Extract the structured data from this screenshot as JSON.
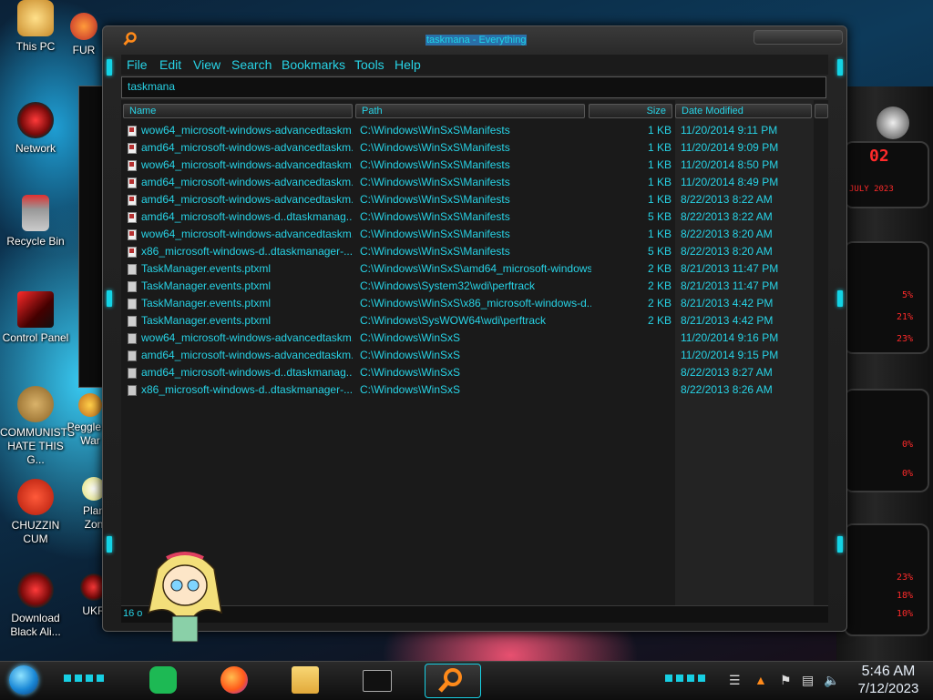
{
  "window": {
    "title": "taskmana - Everything",
    "menu": [
      "File",
      "Edit",
      "View",
      "Search",
      "Bookmarks",
      "Tools",
      "Help"
    ],
    "search_value": "taskmana",
    "columns": {
      "name": "Name",
      "path": "Path",
      "size": "Size",
      "date": "Date Modified"
    },
    "rows": [
      {
        "name": "wow64_microsoft-windows-advancedtaskm...",
        "path": "C:\\Windows\\WinSxS\\Manifests",
        "size": "1 KB",
        "date": "11/20/2014 9:11 PM",
        "icon": "manifest-file-icon"
      },
      {
        "name": "amd64_microsoft-windows-advancedtaskm...",
        "path": "C:\\Windows\\WinSxS\\Manifests",
        "size": "1 KB",
        "date": "11/20/2014 9:09 PM",
        "icon": "manifest-file-icon"
      },
      {
        "name": "wow64_microsoft-windows-advancedtaskm...",
        "path": "C:\\Windows\\WinSxS\\Manifests",
        "size": "1 KB",
        "date": "11/20/2014 8:50 PM",
        "icon": "manifest-file-icon"
      },
      {
        "name": "amd64_microsoft-windows-advancedtaskm...",
        "path": "C:\\Windows\\WinSxS\\Manifests",
        "size": "1 KB",
        "date": "11/20/2014 8:49 PM",
        "icon": "manifest-file-icon"
      },
      {
        "name": "amd64_microsoft-windows-advancedtaskm...",
        "path": "C:\\Windows\\WinSxS\\Manifests",
        "size": "1 KB",
        "date": "8/22/2013 8:22 AM",
        "icon": "manifest-file-icon"
      },
      {
        "name": "amd64_microsoft-windows-d..dtaskmanag...",
        "path": "C:\\Windows\\WinSxS\\Manifests",
        "size": "5 KB",
        "date": "8/22/2013 8:22 AM",
        "icon": "manifest-file-icon"
      },
      {
        "name": "wow64_microsoft-windows-advancedtaskm...",
        "path": "C:\\Windows\\WinSxS\\Manifests",
        "size": "1 KB",
        "date": "8/22/2013 8:20 AM",
        "icon": "manifest-file-icon"
      },
      {
        "name": "x86_microsoft-windows-d..dtaskmanager-...",
        "path": "C:\\Windows\\WinSxS\\Manifests",
        "size": "5 KB",
        "date": "8/22/2013 8:20 AM",
        "icon": "manifest-file-icon"
      },
      {
        "name": "TaskManager.events.ptxml",
        "path": "C:\\Windows\\WinSxS\\amd64_microsoft-windows...",
        "size": "2 KB",
        "date": "8/21/2013 11:47 PM",
        "icon": "xml-file-icon"
      },
      {
        "name": "TaskManager.events.ptxml",
        "path": "C:\\Windows\\System32\\wdi\\perftrack",
        "size": "2 KB",
        "date": "8/21/2013 11:47 PM",
        "icon": "xml-file-icon"
      },
      {
        "name": "TaskManager.events.ptxml",
        "path": "C:\\Windows\\WinSxS\\x86_microsoft-windows-d.....",
        "size": "2 KB",
        "date": "8/21/2013 4:42 PM",
        "icon": "xml-file-icon"
      },
      {
        "name": "TaskManager.events.ptxml",
        "path": "C:\\Windows\\SysWOW64\\wdi\\perftrack",
        "size": "2 KB",
        "date": "8/21/2013 4:42 PM",
        "icon": "xml-file-icon"
      },
      {
        "name": "wow64_microsoft-windows-advancedtaskm...",
        "path": "C:\\Windows\\WinSxS",
        "size": "",
        "date": "11/20/2014 9:16 PM",
        "icon": "folder-icon"
      },
      {
        "name": "amd64_microsoft-windows-advancedtaskm...",
        "path": "C:\\Windows\\WinSxS",
        "size": "",
        "date": "11/20/2014 9:15 PM",
        "icon": "folder-icon"
      },
      {
        "name": "amd64_microsoft-windows-d..dtaskmanag...",
        "path": "C:\\Windows\\WinSxS",
        "size": "",
        "date": "8/22/2013 8:27 AM",
        "icon": "folder-icon"
      },
      {
        "name": "x86_microsoft-windows-d..dtaskmanager-...",
        "path": "C:\\Windows\\WinSxS",
        "size": "",
        "date": "8/22/2013 8:26 AM",
        "icon": "folder-icon"
      }
    ],
    "status_text": "16 o"
  },
  "desktop": {
    "icons": [
      {
        "label": "This PC",
        "icon": "this-pc-icon"
      },
      {
        "label": "Network",
        "icon": "network-icon"
      },
      {
        "label": "Recycle Bin",
        "icon": "recycle-bin-icon"
      },
      {
        "label": "Control Panel",
        "icon": "control-panel-icon"
      },
      {
        "label": "COMMUNISTS HATE THIS G...",
        "icon": "money-bag-icon"
      },
      {
        "label": "CHUZZIN CUM",
        "icon": "chuzzle-icon"
      },
      {
        "label": "Download Black Ali...",
        "icon": "alienware-icon"
      },
      {
        "label": "FUR",
        "icon": "fur-icon"
      },
      {
        "label": "Peggle of War",
        "icon": "peggle-icon"
      },
      {
        "label": "Plan Zon",
        "icon": "plants-icon"
      },
      {
        "label": "UKR",
        "icon": "ukr-icon"
      }
    ]
  },
  "widgets": {
    "date_number": "02",
    "month_text": "JULY 2023",
    "stats": [
      "5%",
      "21%",
      "23%",
      "0%",
      "0%",
      "23%",
      "18%",
      "10%"
    ]
  },
  "taskbar": {
    "pinned": [
      "spotify-icon",
      "firefox-icon",
      "file-explorer-icon",
      "cmd-icon",
      "everything-search-icon"
    ],
    "time": "5:46 AM",
    "date": "7/12/2023"
  },
  "colors": {
    "accent": "#27d3e6",
    "background": "#1a1a1a",
    "title_highlight": "#2a6fa8",
    "widget_red": "#ff2a2a"
  }
}
